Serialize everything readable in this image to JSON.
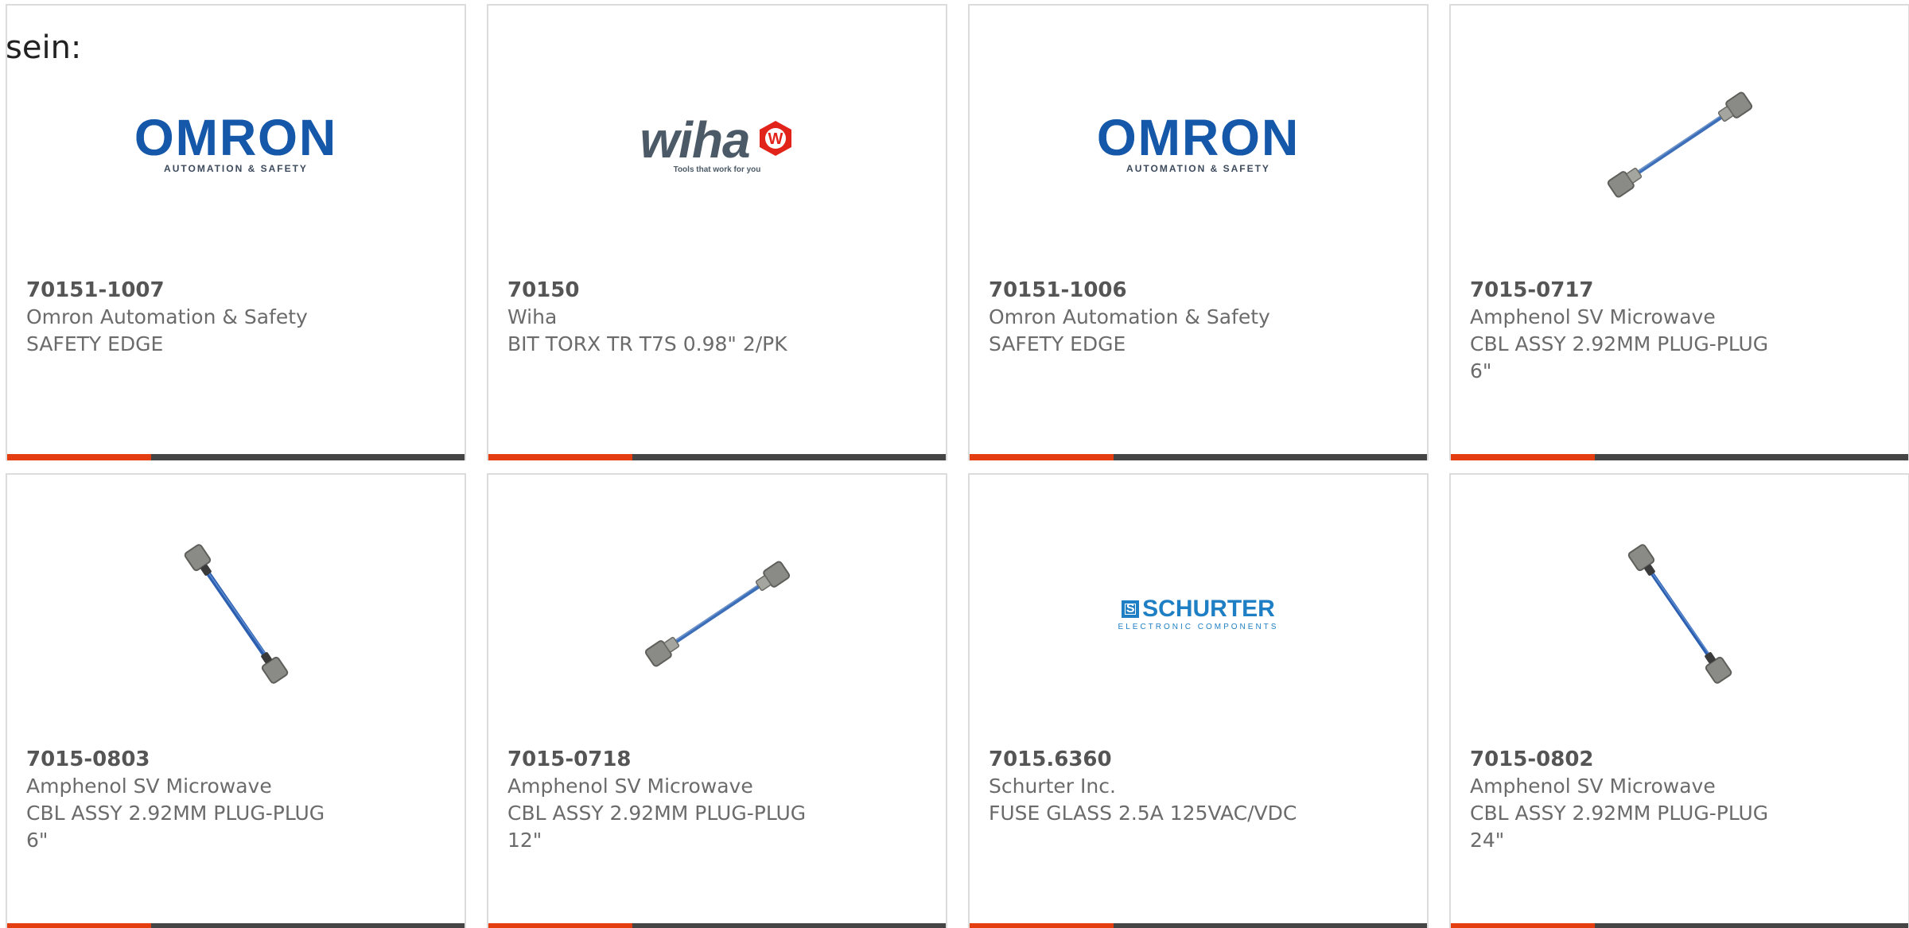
{
  "lead_text": "sein:",
  "colors": {
    "accent": "#e33d10",
    "bar": "#454545",
    "card_border": "#dcdcdc",
    "part_number_text": "#555555",
    "secondary_text": "#6b6b6b",
    "omron_blue": "#1557a8",
    "wiha_gray": "#4b5a66",
    "wiha_red": "#e2231a",
    "schurter_blue": "#1f7fc4",
    "cable_blue": "#3d6fb8"
  },
  "logos": {
    "omron": {
      "word": "OMRON",
      "sub": "AUTOMATION & SAFETY"
    },
    "wiha": {
      "word": "wiha",
      "badge": "W",
      "tagline": "Tools that work for you"
    },
    "schurter": {
      "mark": "S",
      "word": "SCHURTER",
      "sub": "ELECTRONIC COMPONENTS"
    }
  },
  "products": [
    {
      "part_number": "70151-1007",
      "manufacturer": "Omron Automation & Safety",
      "description": "SAFETY EDGE",
      "image": "omron-logo"
    },
    {
      "part_number": "70150",
      "manufacturer": "Wiha",
      "description": "BIT TORX TR T7S 0.98\" 2/PK",
      "image": "wiha-logo"
    },
    {
      "part_number": "70151-1006",
      "manufacturer": "Omron Automation & Safety",
      "description": "SAFETY EDGE",
      "image": "omron-logo"
    },
    {
      "part_number": "7015-0717",
      "manufacturer": "Amphenol SV Microwave",
      "description": "CBL ASSY 2.92MM PLUG-PLUG 6\"",
      "image": "cable-diagonal-up"
    },
    {
      "part_number": "7015-0803",
      "manufacturer": "Amphenol SV Microwave",
      "description": "CBL ASSY 2.92MM PLUG-PLUG 6\"",
      "image": "cable-diagonal-down"
    },
    {
      "part_number": "7015-0718",
      "manufacturer": "Amphenol SV Microwave",
      "description": "CBL ASSY 2.92MM PLUG-PLUG 12\"",
      "image": "cable-diagonal-up"
    },
    {
      "part_number": "7015.6360",
      "manufacturer": "Schurter Inc.",
      "description": "FUSE GLASS 2.5A 125VAC/VDC",
      "image": "schurter-logo"
    },
    {
      "part_number": "7015-0802",
      "manufacturer": "Amphenol SV Microwave",
      "description": "CBL ASSY 2.92MM PLUG-PLUG 24\"",
      "image": "cable-diagonal-down"
    }
  ]
}
